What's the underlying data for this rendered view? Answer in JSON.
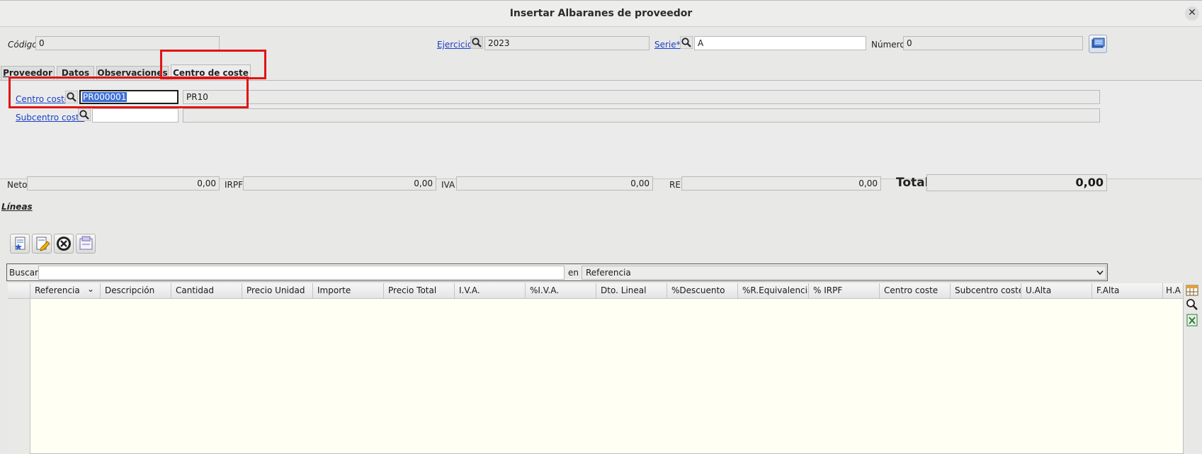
{
  "window": {
    "title": "Insertar Albaranes de proveedor",
    "close_symbol": "✕"
  },
  "header": {
    "codigo_label": "Código",
    "codigo_value": "0",
    "ejercicio_label": "Ejercicio",
    "ejercicio_value": "2023",
    "serie_label": "Serie*",
    "serie_value": "A",
    "numero_label": "Número",
    "numero_value": "0"
  },
  "tabs": [
    {
      "label": "Proveedor",
      "mnemonic": "P"
    },
    {
      "label": "Datos",
      "mnemonic": "D"
    },
    {
      "label": "Observaciones",
      "mnemonic": "O"
    },
    {
      "label": "Centro de coste",
      "mnemonic": "C",
      "active": true
    }
  ],
  "centro_coste": {
    "centro_label": "Centro coste",
    "centro_code": "PR000001",
    "centro_desc": "PR10",
    "subcentro_label": "Subcentro coste",
    "subcentro_code": "",
    "subcentro_desc": ""
  },
  "totals": {
    "neto_label": "Neto",
    "neto_value": "0,00",
    "irpf_label": "IRPF",
    "irpf_value": "0,00",
    "iva_label": "IVA",
    "iva_value": "0,00",
    "re_label": "RE",
    "re_value": "0,00",
    "total_label": "Total",
    "total_value": "0,00"
  },
  "lineas": {
    "section_label": "Líneas",
    "toolbar": [
      "new-line-icon",
      "edit-line-icon",
      "delete-line-icon",
      "import-lines-icon"
    ],
    "search_label": "Buscar",
    "search_value": "",
    "en_label": "en",
    "search_field": "Referencia",
    "columns": [
      "Referencia",
      "Descripción",
      "Cantidad",
      "Precio Unidad",
      "Importe",
      "Precio Total",
      "I.V.A.",
      "%I.V.A.",
      "Dto. Lineal",
      "%Descuento",
      "%R.Equivalencia",
      "% IRPF",
      "Centro coste",
      "Subcentro coste",
      "U.Alta",
      "F.Alta",
      "H.A"
    ],
    "sort_indicator": "⌄",
    "rows": []
  },
  "colors": {
    "link": "#1a3fc4",
    "highlight": "#e01515",
    "selection": "#3d6fd6",
    "grid_bg": "#fffff4"
  }
}
